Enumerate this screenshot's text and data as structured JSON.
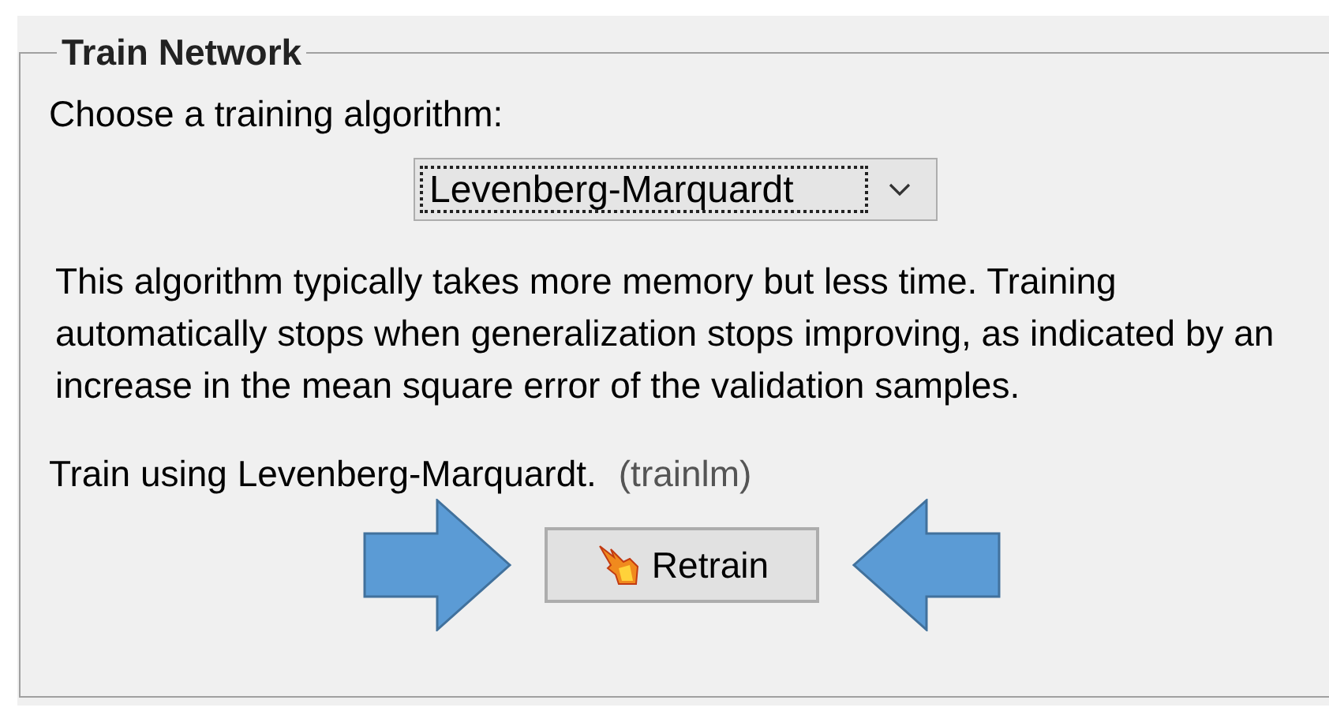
{
  "panel": {
    "title": "Train Network"
  },
  "prompt": "Choose a training algorithm:",
  "algorithm_dropdown": {
    "value": "Levenberg-Marquardt",
    "focused": true
  },
  "description": "This algorithm typically takes more memory but less time. Training automatically stops when generalization stops improving, as indicated by an increase in the mean square error of the validation samples.",
  "summary": "Train using Levenberg-Marquardt.",
  "function_name": "(trainlm)",
  "retrain_button": {
    "label": "Retrain"
  },
  "arrows": [
    {
      "kind": "right"
    },
    {
      "kind": "left"
    }
  ]
}
